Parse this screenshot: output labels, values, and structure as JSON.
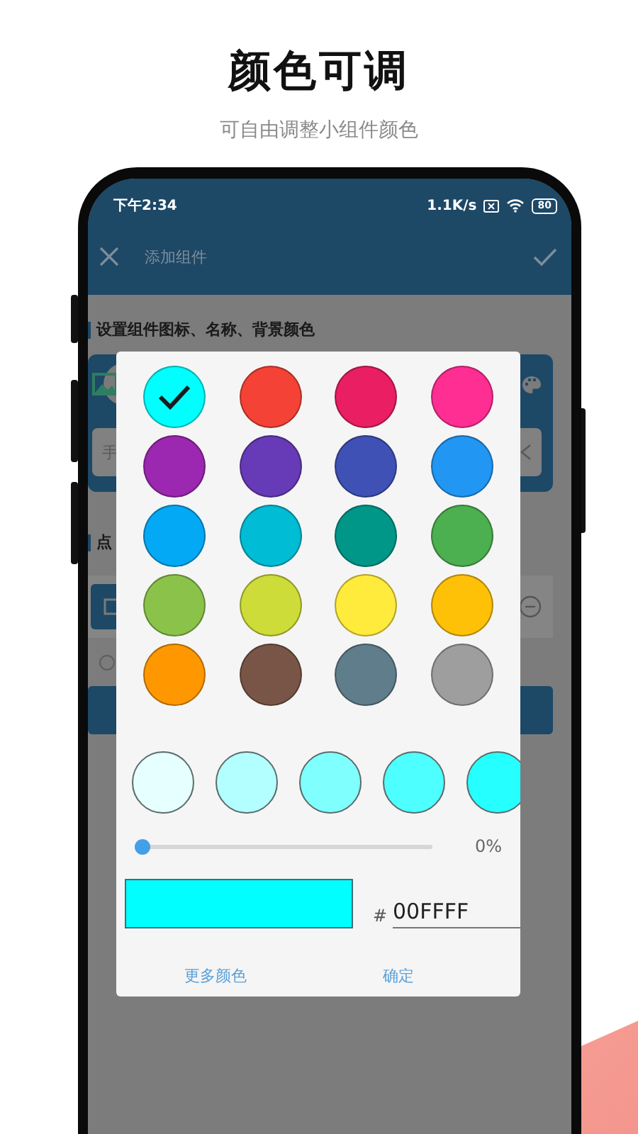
{
  "header": {
    "title": "颜色可调",
    "subtitle": "可自由调整小组件颜色"
  },
  "status_bar": {
    "time": "下午2:34",
    "network_speed": "1.1K/s",
    "battery": "80"
  },
  "toolbar": {
    "title": "添加组件"
  },
  "content": {
    "section_1": "设置组件图标、名称、背景颜色",
    "name_field_fragment": "手",
    "section_2_fragment": "点",
    "option_radio": {
      "checked": false
    }
  },
  "dialog": {
    "palette": [
      {
        "color": "#00ffff",
        "selected": true
      },
      {
        "color": "#f44336",
        "selected": false
      },
      {
        "color": "#e91e63",
        "selected": false
      },
      {
        "color": "#ff2e93",
        "selected": false
      },
      {
        "color": "#9c27b0",
        "selected": false
      },
      {
        "color": "#673ab7",
        "selected": false
      },
      {
        "color": "#3f51b5",
        "selected": false
      },
      {
        "color": "#2196f3",
        "selected": false
      },
      {
        "color": "#03a9f4",
        "selected": false
      },
      {
        "color": "#00bcd4",
        "selected": false
      },
      {
        "color": "#009688",
        "selected": false
      },
      {
        "color": "#4caf50",
        "selected": false
      },
      {
        "color": "#8bc34a",
        "selected": false
      },
      {
        "color": "#cddc39",
        "selected": false
      },
      {
        "color": "#ffeb3b",
        "selected": false
      },
      {
        "color": "#ffc107",
        "selected": false
      },
      {
        "color": "#ff9800",
        "selected": false
      },
      {
        "color": "#795548",
        "selected": false
      },
      {
        "color": "#607d8b",
        "selected": false
      },
      {
        "color": "#9e9e9e",
        "selected": false
      }
    ],
    "shades": [
      {
        "color": "#e6ffff"
      },
      {
        "color": "#b3ffff"
      },
      {
        "color": "#80ffff"
      },
      {
        "color": "#4dffff"
      },
      {
        "color": "#26ffff"
      }
    ],
    "transparency": {
      "level": 0,
      "reading": "0%"
    },
    "hex_prefix": "#",
    "hex_value": "00FFFF",
    "buttons": [
      "更多颜色",
      "确定"
    ]
  }
}
